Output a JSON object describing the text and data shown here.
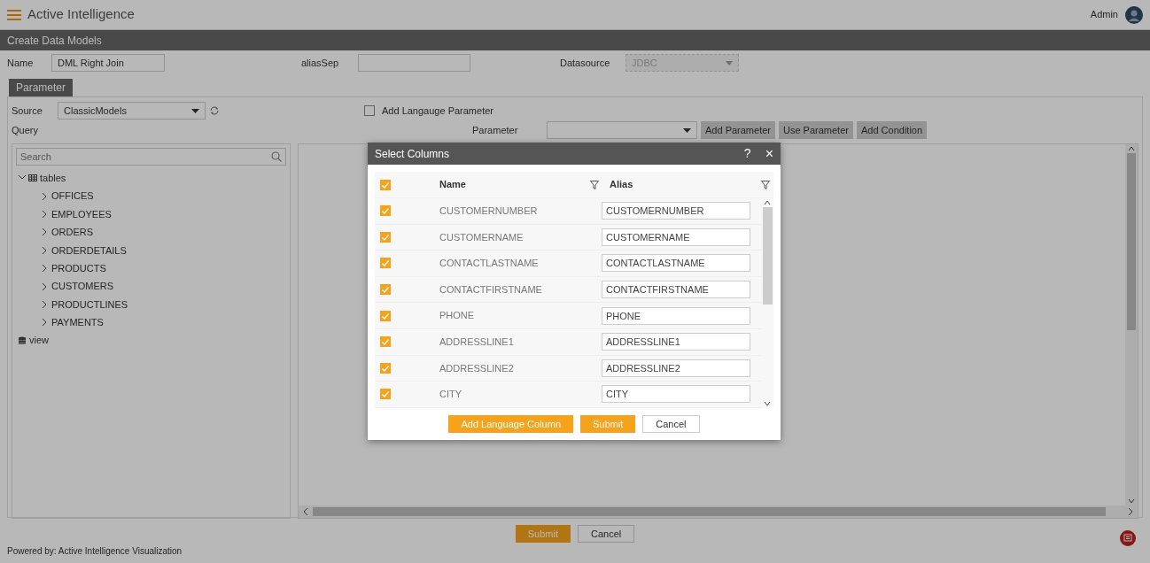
{
  "app": {
    "title": "Active Intelligence",
    "user": "Admin"
  },
  "page_title": "Create Data Models",
  "form": [
    {
      "label": "Name",
      "value": "DML Right Join",
      "kind": "text"
    },
    {
      "label": "aliasSep",
      "kind": "text"
    },
    {
      "label": "Datasource",
      "value": "JDBC",
      "kind": "select",
      "disabled": true
    }
  ],
  "tab": {
    "label": "Parameter",
    "selected": true
  },
  "source": {
    "label": "Source",
    "value": "ClassicModels"
  },
  "add_language_parameter": {
    "label": "Add Langauge Parameter",
    "checked": false
  },
  "query_label": "Query",
  "parameter": {
    "label": "Parameter"
  },
  "parameter_buttons": [
    "Add Parameter",
    "Use Parameter",
    "Add Condition"
  ],
  "search": {
    "placeholder": "Search"
  },
  "tree": [
    {
      "label": "tables",
      "kind": "table",
      "expanded": true,
      "children": [
        {
          "label": "OFFICES",
          "expanded": false
        },
        {
          "label": "EMPLOYEES",
          "expanded": false
        },
        {
          "label": "ORDERS",
          "expanded": false
        },
        {
          "label": "ORDERDETAILS",
          "expanded": false
        },
        {
          "label": "PRODUCTS",
          "expanded": false
        },
        {
          "label": "CUSTOMERS",
          "expanded": false
        },
        {
          "label": "PRODUCTLINES",
          "expanded": false
        },
        {
          "label": "PAYMENTS",
          "expanded": false
        }
      ]
    },
    {
      "label": "view",
      "kind": "view"
    }
  ],
  "form_buttons": [
    {
      "label": "Submit",
      "kind": "primary"
    },
    {
      "label": "Cancel",
      "kind": "secondary"
    }
  ],
  "footer": "Powered by: Active Intelligence Visualization",
  "dialog": {
    "title": "Select Columns",
    "help": "?",
    "close": "×",
    "columns": [
      "Name",
      "Alias"
    ],
    "all_checked": true,
    "rows": [
      {
        "name": "CUSTOMERNUMBER",
        "alias": "CUSTOMERNUMBER",
        "checked": true
      },
      {
        "name": "CUSTOMERNAME",
        "alias": "CUSTOMERNAME",
        "checked": true
      },
      {
        "name": "CONTACTLASTNAME",
        "alias": "CONTACTLASTNAME",
        "checked": true
      },
      {
        "name": "CONTACTFIRSTNAME",
        "alias": "CONTACTFIRSTNAME",
        "checked": true
      },
      {
        "name": "PHONE",
        "alias": "PHONE",
        "checked": true
      },
      {
        "name": "ADDRESSLINE1",
        "alias": "ADDRESSLINE1",
        "checked": true
      },
      {
        "name": "ADDRESSLINE2",
        "alias": "ADDRESSLINE2",
        "checked": true
      },
      {
        "name": "CITY",
        "alias": "CITY",
        "checked": true
      }
    ],
    "buttons": [
      {
        "label": "Add Language Column",
        "kind": "primary"
      },
      {
        "label": "Submit",
        "kind": "primary"
      },
      {
        "label": "Cancel",
        "kind": "secondary"
      }
    ]
  }
}
